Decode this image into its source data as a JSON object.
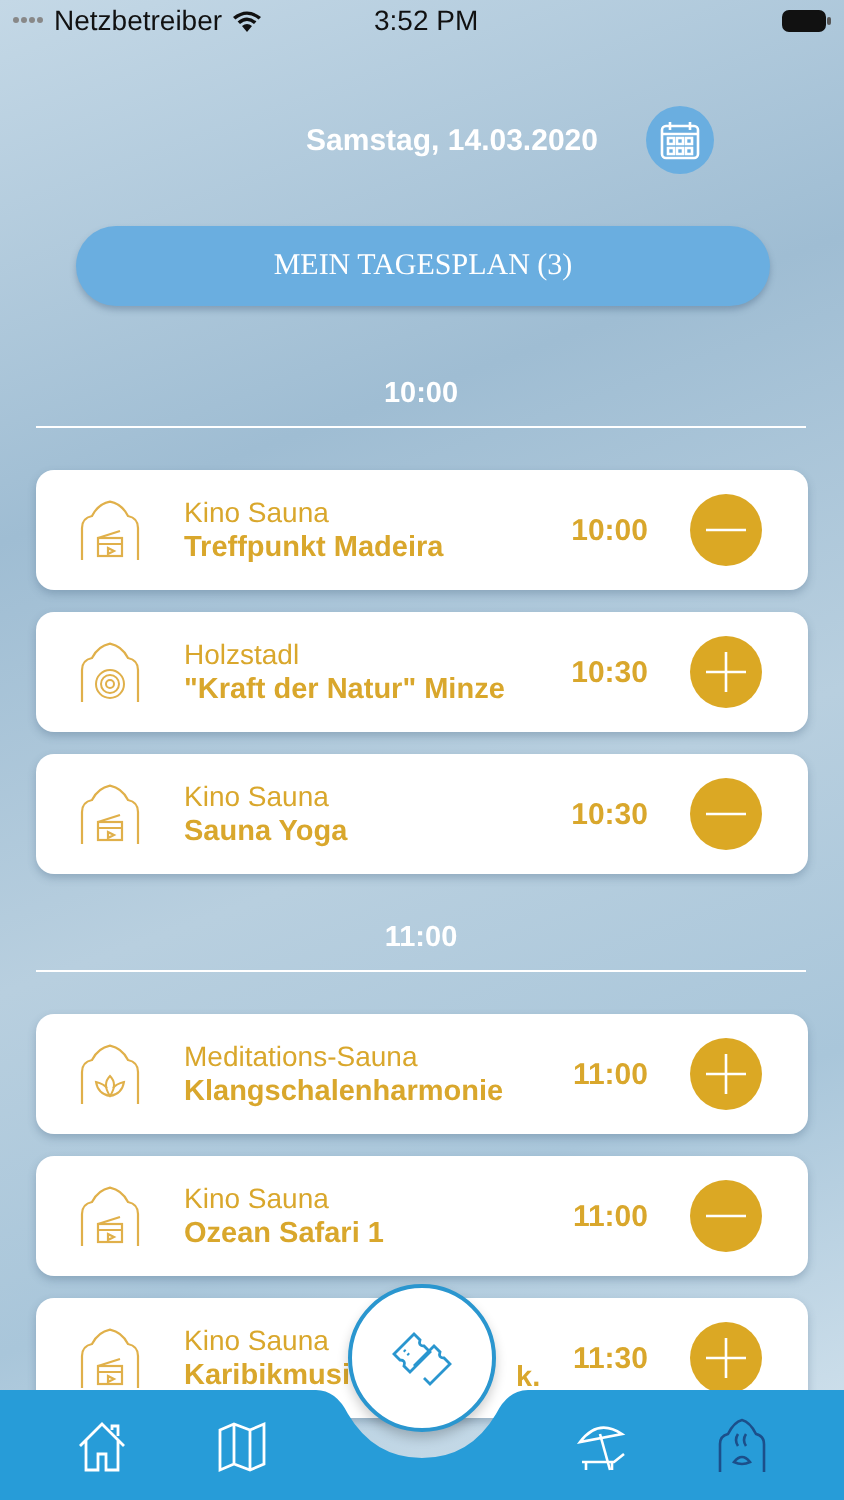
{
  "status_bar": {
    "carrier": "Netzbetreiber",
    "time": "3:52 PM"
  },
  "date": "Samstag, 14.03.2020",
  "plan_button": "MEIN TAGESPLAN (3)",
  "sections": [
    {
      "time": "10:00",
      "events": [
        {
          "kind": "cinema",
          "venue": "Kino Sauna",
          "title": "Treffpunkt Madeira",
          "time": "10:00",
          "in_plan": true
        },
        {
          "kind": "wood",
          "venue": "Holzstadl",
          "title": "\"Kraft der Natur\" Minze",
          "time": "10:30",
          "in_plan": false
        },
        {
          "kind": "cinema",
          "venue": "Kino Sauna",
          "title": "Sauna Yoga",
          "time": "10:30",
          "in_plan": true
        }
      ]
    },
    {
      "time": "11:00",
      "events": [
        {
          "kind": "lotus",
          "venue": "Meditations-Sauna",
          "title": "Klangschalenharmonie",
          "time": "11:00",
          "in_plan": false
        },
        {
          "kind": "cinema",
          "venue": "Kino Sauna",
          "title": "Ozean Safari 1",
          "time": "11:00",
          "in_plan": true
        },
        {
          "kind": "cinema",
          "venue": "Kino Sauna",
          "title": "Karibikmusi",
          "title_tail": "k.",
          "time": "11:30",
          "in_plan": false
        }
      ]
    }
  ],
  "tab_bar": [
    {
      "kind": "home",
      "selected": false
    },
    {
      "kind": "map",
      "selected": false
    },
    {
      "kind": "ticket",
      "selected": false
    },
    {
      "kind": "beach",
      "selected": false
    },
    {
      "kind": "sauna",
      "selected": true
    }
  ]
}
